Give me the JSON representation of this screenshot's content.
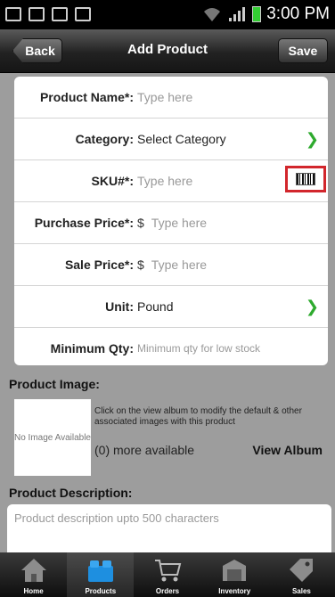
{
  "status_bar": {
    "time": "3:00 PM"
  },
  "nav": {
    "back": "Back",
    "title": "Add Product",
    "save": "Save"
  },
  "form": {
    "product_name": {
      "label": "Product Name*:",
      "placeholder": "Type here"
    },
    "category": {
      "label": "Category:",
      "value": "Select Category"
    },
    "sku": {
      "label": "SKU#*:",
      "placeholder": "Type here"
    },
    "purchase_price": {
      "label": "Purchase Price*:",
      "currency": "$",
      "placeholder": "Type here"
    },
    "sale_price": {
      "label": "Sale Price*:",
      "currency": "$",
      "placeholder": "Type here"
    },
    "unit": {
      "label": "Unit:",
      "value": "Pound"
    },
    "min_qty": {
      "label": "Minimum Qty:",
      "placeholder": "Minimum qty for low stock"
    }
  },
  "product_image": {
    "title": "Product Image:",
    "no_image": "No Image Available",
    "description": "Click on the view album to modify the default & other associated images with this product",
    "more": "(0) more available",
    "view_album": "View Album"
  },
  "product_description": {
    "title": "Product Description:",
    "placeholder": "Product description upto 500 characters"
  },
  "tabs": [
    {
      "label": "Home",
      "icon": "home-icon"
    },
    {
      "label": "Products",
      "icon": "products-icon"
    },
    {
      "label": "Orders",
      "icon": "cart-icon"
    },
    {
      "label": "Inventory",
      "icon": "inventory-icon"
    },
    {
      "label": "Sales",
      "icon": "tag-icon"
    }
  ],
  "colors": {
    "accent_green": "#2eaa2e",
    "highlight_red": "#d2262c",
    "products_blue": "#1e8fe0"
  }
}
